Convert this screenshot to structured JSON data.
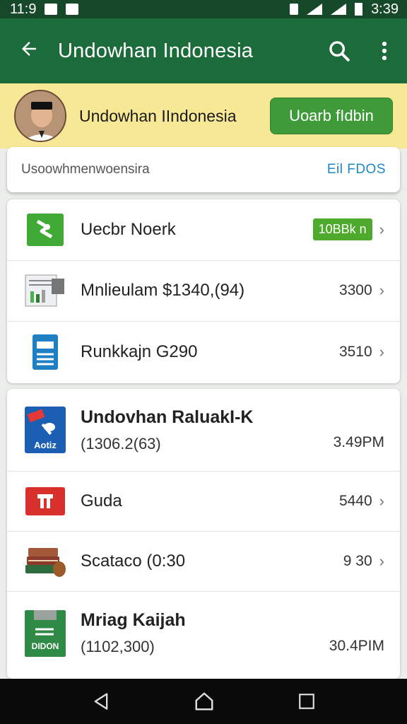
{
  "status_bar": {
    "time_left": "11:9",
    "time_right": "3:39"
  },
  "app_bar": {
    "title": "Undowhan Indonesia",
    "back_icon": "arrow-back-icon",
    "search_icon": "search-icon",
    "more_icon": "more-vert-icon",
    "color": "#1c6b3a"
  },
  "banner": {
    "title": "Undowhan IIndonesia",
    "button_label": "Uoarb fIdbin",
    "background": "#f7e896",
    "button_color": "#3f9a3a"
  },
  "search": {
    "placeholder": "Usoowhmenwoensira",
    "link": "Eil FDOS"
  },
  "list1": [
    {
      "icon": "green-arrow-icon",
      "label": "Uecbr Noerk",
      "badge": "10BBk n"
    },
    {
      "icon": "document-chart-icon",
      "label": "Mnlieulam $1340,(94)",
      "value": "3300"
    },
    {
      "icon": "blue-document-icon",
      "label": "Runkkajn G290",
      "value": "3510"
    }
  ],
  "list2": [
    {
      "icon": "app-document-icon",
      "icon_label": "Aotiz",
      "label": "Undovhan RaluakI-K",
      "sub": "(1306.2(63)",
      "value": "3.49PM"
    },
    {
      "icon": "red-app-icon",
      "label": "Guda",
      "value": "5440"
    },
    {
      "icon": "books-icon",
      "label": "Scataco (0:30",
      "value": "9 30"
    },
    {
      "icon": "green-document-icon",
      "icon_label": "DIDON",
      "label": "Mriag Kaijah",
      "sub": "(1102,300)",
      "value": "30.4PIM"
    }
  ],
  "nav": {
    "back": "nav-back-icon",
    "home": "nav-home-icon",
    "recents": "nav-recents-icon"
  }
}
